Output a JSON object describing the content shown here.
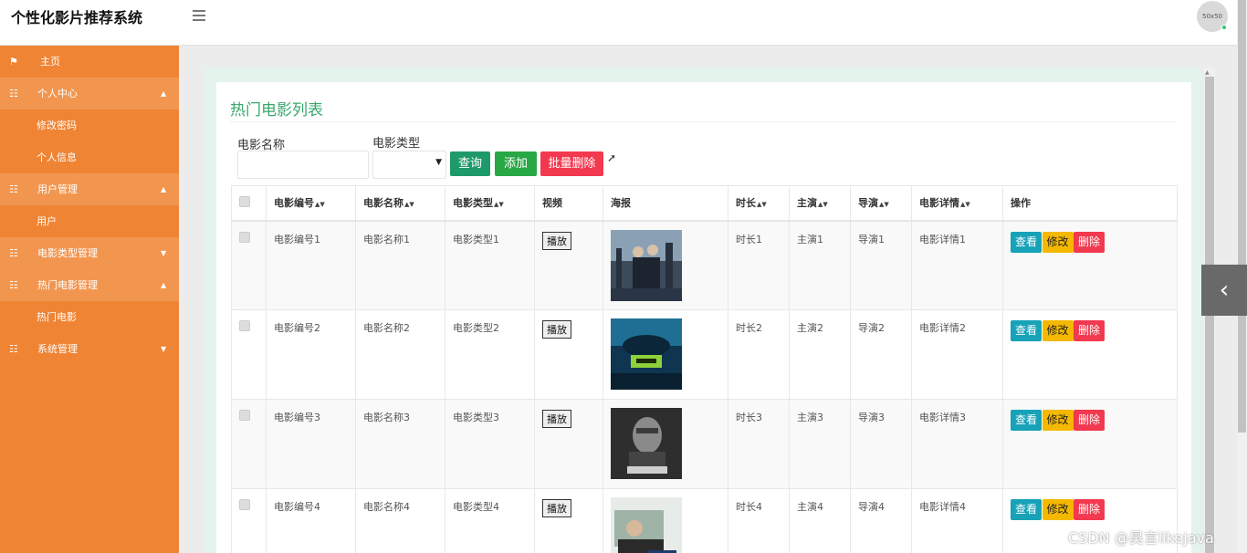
{
  "header": {
    "app_title": "个性化影片推荐系统",
    "avatar_text": "50x50"
  },
  "sidebar": {
    "items": [
      {
        "label": "主页",
        "icon": "flag-icon",
        "type": "item",
        "expandable": false
      },
      {
        "label": "个人中心",
        "icon": "grid-icon",
        "type": "group",
        "expanded": true,
        "children": [
          "修改密码",
          "个人信息"
        ]
      },
      {
        "label": "用户管理",
        "icon": "grid-icon",
        "type": "group",
        "expanded": true,
        "children": [
          "用户"
        ]
      },
      {
        "label": "电影类型管理",
        "icon": "grid-icon",
        "type": "group",
        "expanded": false
      },
      {
        "label": "热门电影管理",
        "icon": "grid-icon",
        "type": "group",
        "expanded": true,
        "children": [
          "热门电影"
        ]
      },
      {
        "label": "系统管理",
        "icon": "grid-icon",
        "type": "group",
        "expanded": false
      }
    ]
  },
  "page": {
    "title": "热门电影列表"
  },
  "filters": {
    "movie_name_label": "电影名称",
    "movie_name_value": "",
    "movie_type_label": "电影类型",
    "movie_type_value": ""
  },
  "actions": {
    "search": "查询",
    "add": "添加",
    "batch_delete": "批量删除"
  },
  "table": {
    "columns": [
      "电影编号",
      "电影名称",
      "电影类型",
      "视频",
      "海报",
      "时长",
      "主演",
      "导演",
      "电影详情",
      "操作"
    ],
    "rows": [
      {
        "id": "电影编号1",
        "name": "电影名称1",
        "type": "电影类型1",
        "play": "播放",
        "duration": "时长1",
        "actor": "主演1",
        "director": "导演1",
        "detail": "电影详情1"
      },
      {
        "id": "电影编号2",
        "name": "电影名称2",
        "type": "电影类型2",
        "play": "播放",
        "duration": "时长2",
        "actor": "主演2",
        "director": "导演2",
        "detail": "电影详情2"
      },
      {
        "id": "电影编号3",
        "name": "电影名称3",
        "type": "电影类型3",
        "play": "播放",
        "duration": "时长3",
        "actor": "主演3",
        "director": "导演3",
        "detail": "电影详情3"
      },
      {
        "id": "电影编号4",
        "name": "电影名称4",
        "type": "电影类型4",
        "play": "播放",
        "duration": "时长4",
        "actor": "主演4",
        "director": "导演4",
        "detail": "电影详情4"
      }
    ],
    "row_actions": {
      "view": "查看",
      "edit": "修改",
      "delete": "删除"
    }
  },
  "colors": {
    "sidebar": "#ef8434",
    "title_green": "#3aa76d",
    "search": "#1e9a6a",
    "add": "#28a745",
    "delete": "#f2394f",
    "view": "#17a2b8",
    "edit": "#f5b800"
  },
  "watermark": "CSDN @昊言likeJava"
}
